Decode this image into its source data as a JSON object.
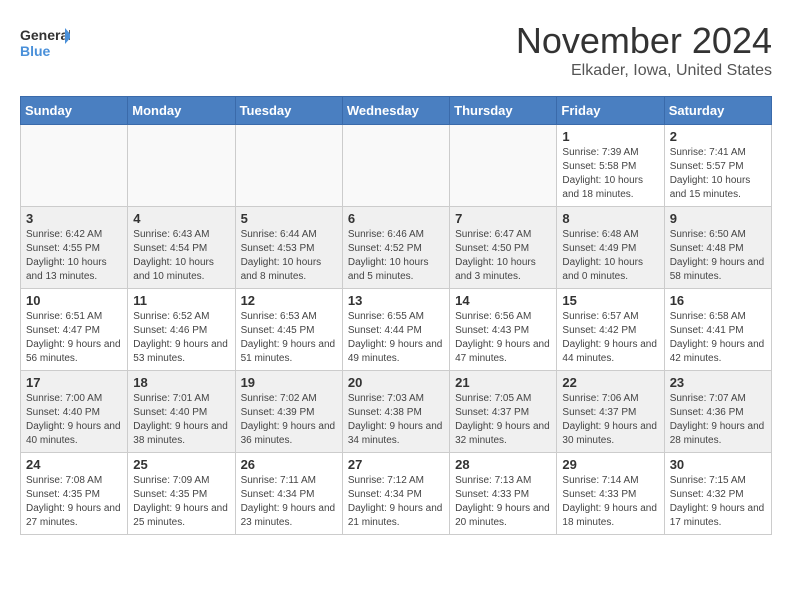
{
  "logo": {
    "line1": "General",
    "line2": "Blue"
  },
  "title": "November 2024",
  "location": "Elkader, Iowa, United States",
  "weekdays": [
    "Sunday",
    "Monday",
    "Tuesday",
    "Wednesday",
    "Thursday",
    "Friday",
    "Saturday"
  ],
  "weeks": [
    [
      {
        "day": "",
        "info": ""
      },
      {
        "day": "",
        "info": ""
      },
      {
        "day": "",
        "info": ""
      },
      {
        "day": "",
        "info": ""
      },
      {
        "day": "",
        "info": ""
      },
      {
        "day": "1",
        "info": "Sunrise: 7:39 AM\nSunset: 5:58 PM\nDaylight: 10 hours and 18 minutes."
      },
      {
        "day": "2",
        "info": "Sunrise: 7:41 AM\nSunset: 5:57 PM\nDaylight: 10 hours and 15 minutes."
      }
    ],
    [
      {
        "day": "3",
        "info": "Sunrise: 6:42 AM\nSunset: 4:55 PM\nDaylight: 10 hours and 13 minutes."
      },
      {
        "day": "4",
        "info": "Sunrise: 6:43 AM\nSunset: 4:54 PM\nDaylight: 10 hours and 10 minutes."
      },
      {
        "day": "5",
        "info": "Sunrise: 6:44 AM\nSunset: 4:53 PM\nDaylight: 10 hours and 8 minutes."
      },
      {
        "day": "6",
        "info": "Sunrise: 6:46 AM\nSunset: 4:52 PM\nDaylight: 10 hours and 5 minutes."
      },
      {
        "day": "7",
        "info": "Sunrise: 6:47 AM\nSunset: 4:50 PM\nDaylight: 10 hours and 3 minutes."
      },
      {
        "day": "8",
        "info": "Sunrise: 6:48 AM\nSunset: 4:49 PM\nDaylight: 10 hours and 0 minutes."
      },
      {
        "day": "9",
        "info": "Sunrise: 6:50 AM\nSunset: 4:48 PM\nDaylight: 9 hours and 58 minutes."
      }
    ],
    [
      {
        "day": "10",
        "info": "Sunrise: 6:51 AM\nSunset: 4:47 PM\nDaylight: 9 hours and 56 minutes."
      },
      {
        "day": "11",
        "info": "Sunrise: 6:52 AM\nSunset: 4:46 PM\nDaylight: 9 hours and 53 minutes."
      },
      {
        "day": "12",
        "info": "Sunrise: 6:53 AM\nSunset: 4:45 PM\nDaylight: 9 hours and 51 minutes."
      },
      {
        "day": "13",
        "info": "Sunrise: 6:55 AM\nSunset: 4:44 PM\nDaylight: 9 hours and 49 minutes."
      },
      {
        "day": "14",
        "info": "Sunrise: 6:56 AM\nSunset: 4:43 PM\nDaylight: 9 hours and 47 minutes."
      },
      {
        "day": "15",
        "info": "Sunrise: 6:57 AM\nSunset: 4:42 PM\nDaylight: 9 hours and 44 minutes."
      },
      {
        "day": "16",
        "info": "Sunrise: 6:58 AM\nSunset: 4:41 PM\nDaylight: 9 hours and 42 minutes."
      }
    ],
    [
      {
        "day": "17",
        "info": "Sunrise: 7:00 AM\nSunset: 4:40 PM\nDaylight: 9 hours and 40 minutes."
      },
      {
        "day": "18",
        "info": "Sunrise: 7:01 AM\nSunset: 4:40 PM\nDaylight: 9 hours and 38 minutes."
      },
      {
        "day": "19",
        "info": "Sunrise: 7:02 AM\nSunset: 4:39 PM\nDaylight: 9 hours and 36 minutes."
      },
      {
        "day": "20",
        "info": "Sunrise: 7:03 AM\nSunset: 4:38 PM\nDaylight: 9 hours and 34 minutes."
      },
      {
        "day": "21",
        "info": "Sunrise: 7:05 AM\nSunset: 4:37 PM\nDaylight: 9 hours and 32 minutes."
      },
      {
        "day": "22",
        "info": "Sunrise: 7:06 AM\nSunset: 4:37 PM\nDaylight: 9 hours and 30 minutes."
      },
      {
        "day": "23",
        "info": "Sunrise: 7:07 AM\nSunset: 4:36 PM\nDaylight: 9 hours and 28 minutes."
      }
    ],
    [
      {
        "day": "24",
        "info": "Sunrise: 7:08 AM\nSunset: 4:35 PM\nDaylight: 9 hours and 27 minutes."
      },
      {
        "day": "25",
        "info": "Sunrise: 7:09 AM\nSunset: 4:35 PM\nDaylight: 9 hours and 25 minutes."
      },
      {
        "day": "26",
        "info": "Sunrise: 7:11 AM\nSunset: 4:34 PM\nDaylight: 9 hours and 23 minutes."
      },
      {
        "day": "27",
        "info": "Sunrise: 7:12 AM\nSunset: 4:34 PM\nDaylight: 9 hours and 21 minutes."
      },
      {
        "day": "28",
        "info": "Sunrise: 7:13 AM\nSunset: 4:33 PM\nDaylight: 9 hours and 20 minutes."
      },
      {
        "day": "29",
        "info": "Sunrise: 7:14 AM\nSunset: 4:33 PM\nDaylight: 9 hours and 18 minutes."
      },
      {
        "day": "30",
        "info": "Sunrise: 7:15 AM\nSunset: 4:32 PM\nDaylight: 9 hours and 17 minutes."
      }
    ]
  ]
}
